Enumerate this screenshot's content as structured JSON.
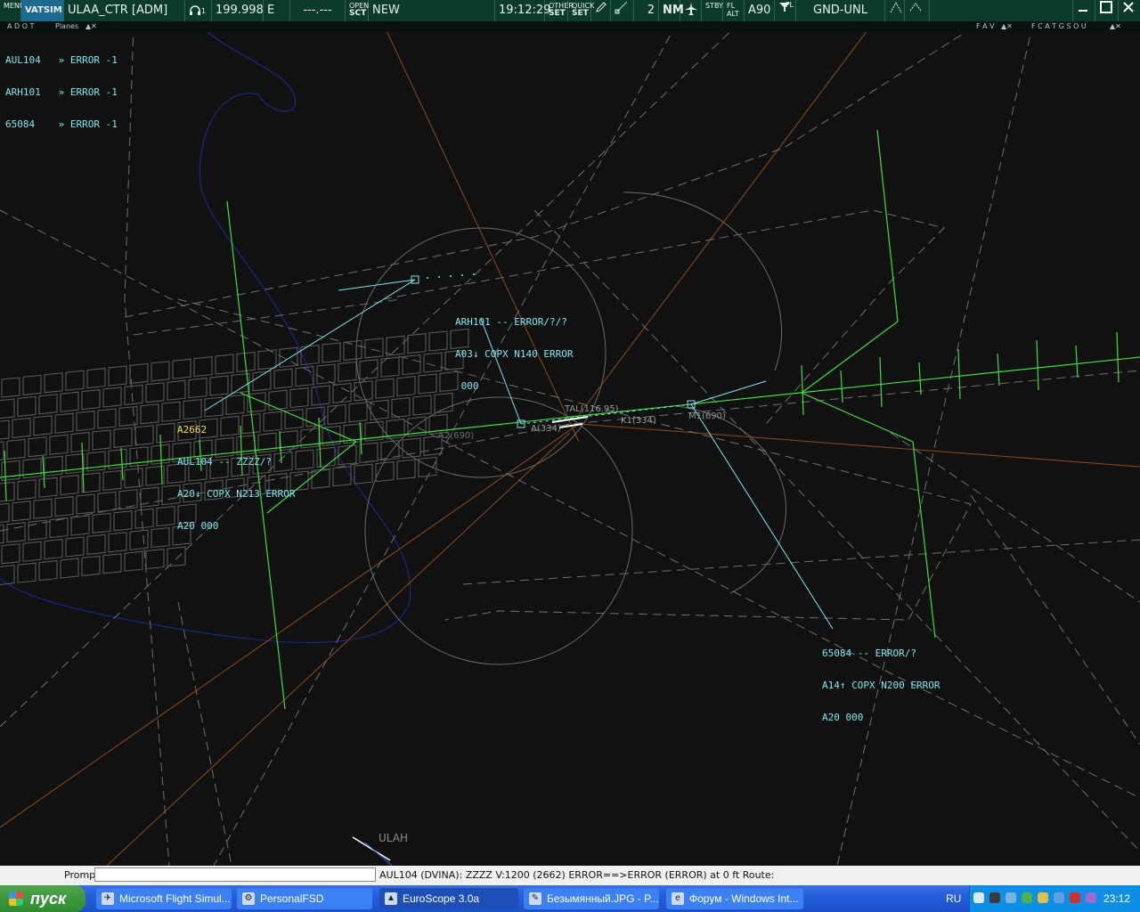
{
  "topbar": {
    "menu_label": "MENU",
    "vatsim_label": "VATSIM",
    "callsign": "ULAA_CTR [ADM]",
    "headset_sub": "1",
    "frequency": "199.998",
    "facility": "E",
    "atis": "---.---",
    "open_label": "OPEN",
    "sct_label": "SCT",
    "new_label": "NEW",
    "time": "19:12:29",
    "other_label": "OTHER",
    "other_set": "SET",
    "quick_label": "QUICK",
    "quick_set": "SET",
    "count": "2",
    "nm_label": "NM",
    "stby_label": "STBY",
    "fl_label": "FL",
    "alt_label": "ALT",
    "alt_ref": "A90",
    "fl_small": "FL",
    "range": "GND-UNL"
  },
  "subbar": {
    "left_letters": "A D O T",
    "planes_label": "Planes",
    "right_letters_1": "F A V",
    "right_letters_2": "F C A T G S O U"
  },
  "alerts": [
    {
      "callsign": "AUL104",
      "text": "» ERROR -1"
    },
    {
      "callsign": "ARH101",
      "text": "» ERROR -1"
    },
    {
      "callsign": "65084",
      "text": "» ERROR -1"
    }
  ],
  "tags": {
    "arh101": {
      "l1": "ARH101 -- ERROR/?/?",
      "l2": "A03↓ COPX N140 ERROR",
      "l3": " 000"
    },
    "aul104": {
      "squawk": "A2662",
      "l1": "AUL104 -- ZZZZ/?",
      "l2": "A20↓ COPX N213 ERROR",
      "l3": "A20 000"
    },
    "t65084": {
      "l1": "65084 -- ERROR/?",
      "l2": "A14↑ COPX N200 ERROR",
      "l3": "A20 000"
    }
  },
  "fixes": {
    "tal": "TAL(116.95)",
    "k1": "K1(334)",
    "a334": "A(334)",
    "a2": "A2(690)",
    "m1": "M1(690)",
    "ulah": "ULAH"
  },
  "prompt": {
    "label": "Prompt",
    "value": "",
    "flightplan": "AUL104 (DVINA): ZZZZ V:1200 (2662) ERROR==>ERROR (ERROR) at 0 ft Route:"
  },
  "taskbar": {
    "start_label": "пуск",
    "items": [
      {
        "label": "Microsoft Flight Simul..."
      },
      {
        "label": "PersonalFSD"
      },
      {
        "label": "EuroScope 3.0a"
      },
      {
        "label": "Безымянный.JPG - P..."
      },
      {
        "label": "Форум - Windows Int..."
      }
    ],
    "lang": "RU",
    "clock": "23:12"
  },
  "colors": {
    "background": "#111111",
    "topbar": "#0d3b2a",
    "tag": "#7fe7f0",
    "runway": "#3ee03e",
    "airspace": "#7a7a7a",
    "route": "#b0601e",
    "boundary": "#1c2a9a"
  }
}
